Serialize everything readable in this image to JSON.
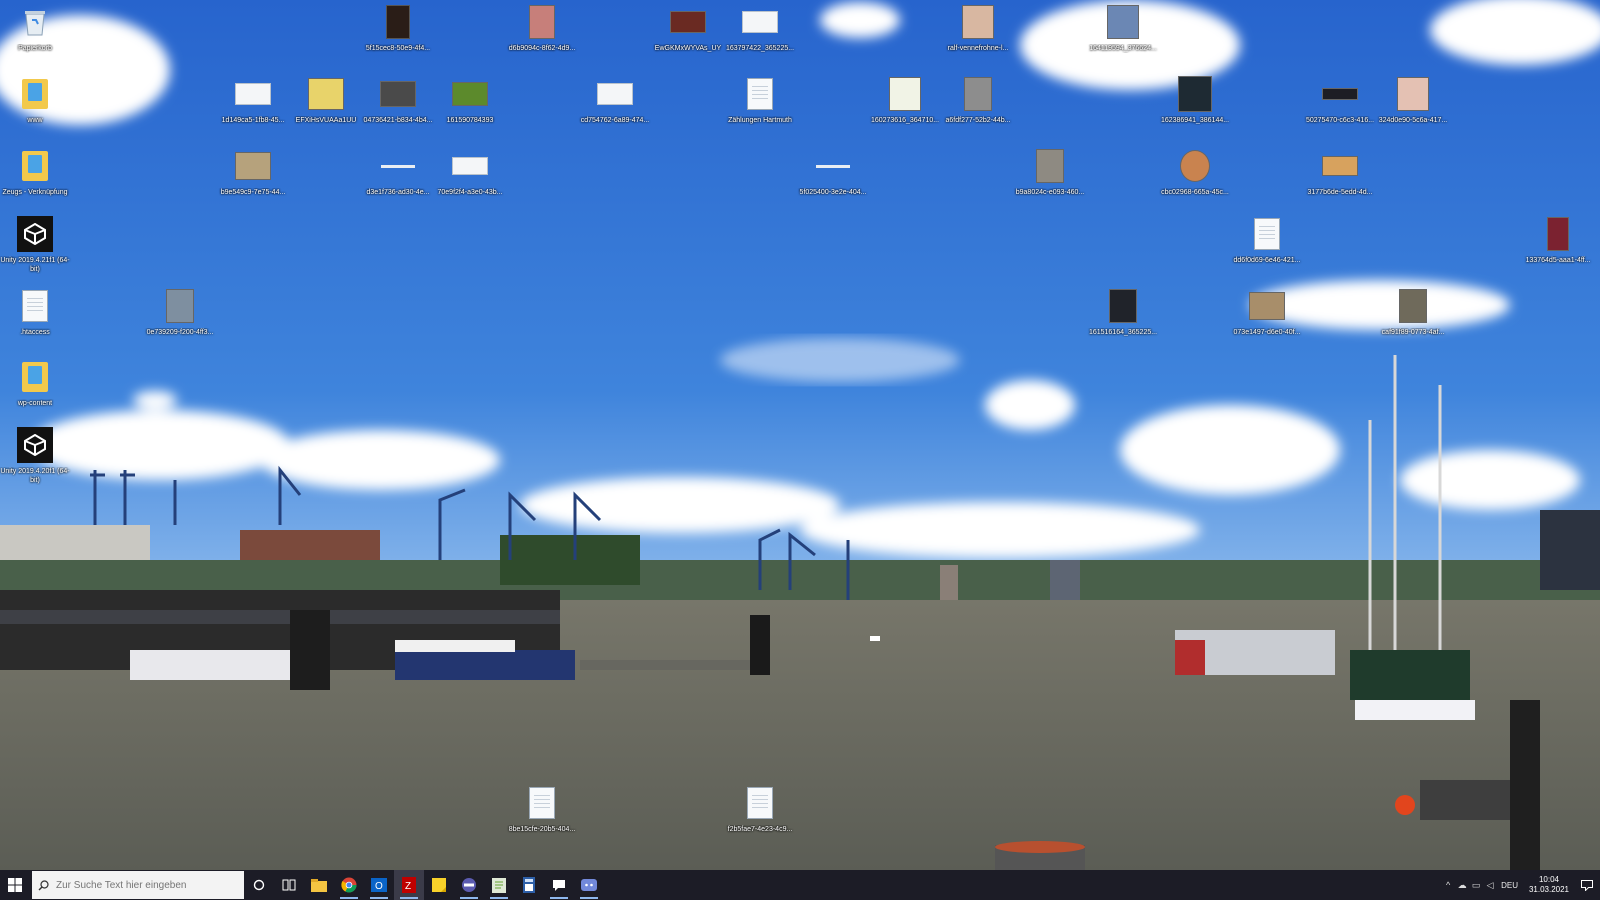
{
  "desktop": {
    "icons": [
      {
        "label": "Papierkorb",
        "kind": "bin"
      },
      {
        "label": "www",
        "kind": "folder"
      },
      {
        "label": "Zeugs - Verknüpfung",
        "kind": "shortcut"
      },
      {
        "label": "Unity 2019.4.21f1 (64-bit)",
        "kind": "unity"
      },
      {
        "label": ".htaccess",
        "kind": "doc"
      },
      {
        "label": "wp-content",
        "kind": "folder"
      },
      {
        "label": "Unity 2019.4.20f1 (64-bit)",
        "kind": "unity"
      },
      {
        "label": "5f15cec8-50e9-4f4...",
        "kind": "dark"
      },
      {
        "label": "d6b9094c-8f62-4d9...",
        "kind": "photo-red"
      },
      {
        "label": "EwGKMxWYVAs_UY",
        "kind": "photo-red"
      },
      {
        "label": "163797422_365225...",
        "kind": "wide"
      },
      {
        "label": "ralf-vennefrohne-l...",
        "kind": "face"
      },
      {
        "label": "164119594_376624...",
        "kind": "photo-blue"
      },
      {
        "label": "1d149ca5-1fb8-45...",
        "kind": "wide"
      },
      {
        "label": "EFXiHsVUAAa1UU",
        "kind": "photo-yellow"
      },
      {
        "label": "04736421-b834-4b4...",
        "kind": "photo-grey"
      },
      {
        "label": "161590784393",
        "kind": "photo-green"
      },
      {
        "label": "cd754762-6a89-474...",
        "kind": "wide"
      },
      {
        "label": "Zählungen Hartmuth",
        "kind": "doc"
      },
      {
        "label": "160273616_364710...",
        "kind": "photo-lightgreen"
      },
      {
        "label": "a6fdf277-52b2-44b...",
        "kind": "photo-grey"
      },
      {
        "label": "162386941_386144...",
        "kind": "photo-dark"
      },
      {
        "label": "50275470-c6c3-416...",
        "kind": "photo-dark-small"
      },
      {
        "label": "324d0e90-5c6a-417...",
        "kind": "photo-pink"
      },
      {
        "label": "b9e549c9-7e75-44...",
        "kind": "photo-tan"
      },
      {
        "label": "d3e1f736-ad30-4e...",
        "kind": "line"
      },
      {
        "label": "70e9f2f4-a3e0-43b...",
        "kind": "wide"
      },
      {
        "label": "5f025400-3e2e-404...",
        "kind": "line"
      },
      {
        "label": "b9a8024c-e093-460...",
        "kind": "photo-grey"
      },
      {
        "label": "cbc02968-665a-45c...",
        "kind": "photo-food"
      },
      {
        "label": "3177b6de-5edd-4d...",
        "kind": "photo-food"
      },
      {
        "label": "dd6f0d69-6e46-421...",
        "kind": "doc"
      },
      {
        "label": "133764d5-aaa1-4ff...",
        "kind": "photo-red"
      },
      {
        "label": "0e739209-f200-4ff3...",
        "kind": "face"
      },
      {
        "label": "161516164_365225...",
        "kind": "photo-dark"
      },
      {
        "label": "073e1497-d6e0-40f...",
        "kind": "photo-tan"
      },
      {
        "label": "caf91f89-0773-4af...",
        "kind": "photo-grey"
      },
      {
        "label": "8be15cfe-20b5-404...",
        "kind": "doc"
      },
      {
        "label": "f2b5fae7-4e23-4c9...",
        "kind": "doc"
      }
    ]
  },
  "taskbar": {
    "search_placeholder": "Zur Suche Text hier eingeben",
    "pinned": [
      "cortana",
      "task-view",
      "file-explorer",
      "chrome",
      "outlook",
      "filezilla",
      "sticky-notes",
      "vpn",
      "notepad-plus",
      "calculator",
      "chat",
      "discord"
    ],
    "language": "DEU",
    "time": "10:04",
    "date": "31.03.2021"
  },
  "colors": {
    "sky_top": "#2a66cf",
    "sky_mid": "#4d8ee0",
    "water": "#6d6e63",
    "taskbar": "#1c1c26"
  }
}
